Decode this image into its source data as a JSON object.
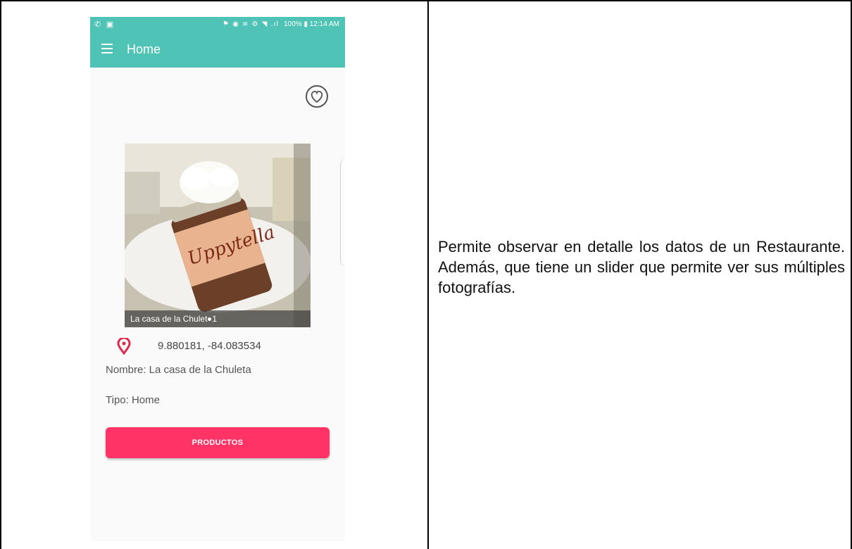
{
  "phone": {
    "status_bar": {
      "left_icons": "✆ ▣",
      "right_icons": "⚑ ◉ ≡ ⚙ ◥ .ıl",
      "battery": "100%",
      "time": "12:14 AM"
    },
    "toolbar": {
      "title": "Home"
    },
    "slider": {
      "caption": "La casa de la Chulet",
      "caption_suffix": "1"
    },
    "details": {
      "coordinates": "9.880181, -84.083534",
      "name": "Nombre: La casa de la Chuleta",
      "type": "Tipo: Home"
    },
    "productos_button": "PRODUCTOS",
    "colors": {
      "toolbar": "#4fc3b6",
      "button": "#ff3366",
      "pin": "#e0294f"
    }
  },
  "description": "Permite observar en detalle los datos de un Restaurante. Además, que tiene un slider que permite ver sus múltiples fotografías."
}
